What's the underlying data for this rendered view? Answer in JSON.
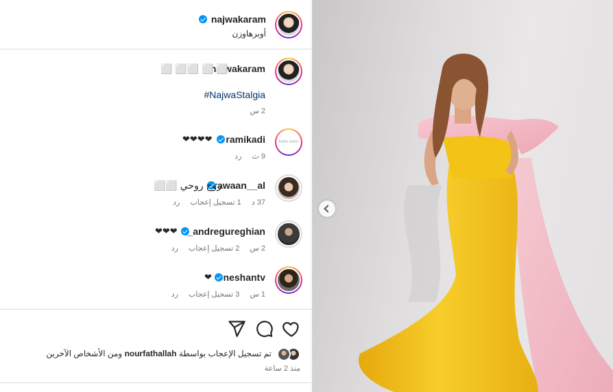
{
  "header": {
    "username": "najwakaram",
    "location": "أوبرهاوزن"
  },
  "caption": {
    "username": "najwakaram",
    "text": "⬜ ⬜ ⬜⬜ ⬜",
    "hashtag": "#NajwaStalgia",
    "time": "2 س"
  },
  "comments": [
    {
      "username": "ramikadi",
      "text": "❤❤❤❤",
      "time": "9 ث",
      "likes": "",
      "reply": "رد",
      "avatar_text": "RAMI KADI"
    },
    {
      "username": "rawaan__al",
      "text": "روح روحي ⬜⬜",
      "time": "37 د",
      "likes": "1 تسجيل إعجاب",
      "reply": "رد"
    },
    {
      "username": "_andregureghian",
      "text": "❤❤❤",
      "time": "2 س",
      "likes": "2 تسجيل إعجاب",
      "reply": "رد"
    },
    {
      "username": "neshantv",
      "text": "❤",
      "time": "1 س",
      "likes": "3 تسجيل إعجاب",
      "reply": "رد"
    }
  ],
  "footer": {
    "liked_by_prefix": "تم تسجيل الإعجاب بواسطة",
    "liked_by_user": "nourfathallah",
    "liked_by_suffix": "ومن الأشخاص الآخرين",
    "time_ago": "منذ 2 ساعة"
  },
  "icons": [
    "heart-icon",
    "comment-icon",
    "share-icon",
    "chevron-left-icon",
    "verified-badge-icon"
  ],
  "colors": {
    "accent": "#0095f6",
    "hashtag": "#00376b",
    "dress": "#f3c318",
    "stole": "#f4b9c5"
  }
}
